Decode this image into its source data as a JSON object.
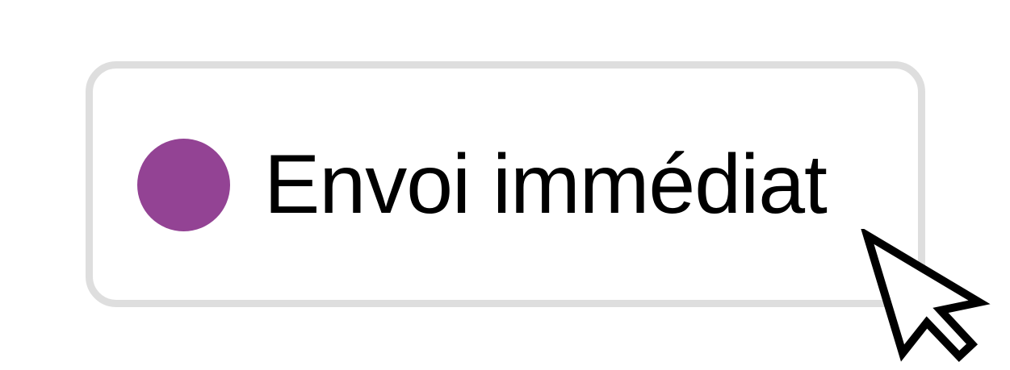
{
  "option": {
    "label": "Envoi immédiat",
    "dot_color": "#934394",
    "border_color": "#dedede"
  },
  "cursor": {
    "icon": "arrow-pointer-icon"
  }
}
